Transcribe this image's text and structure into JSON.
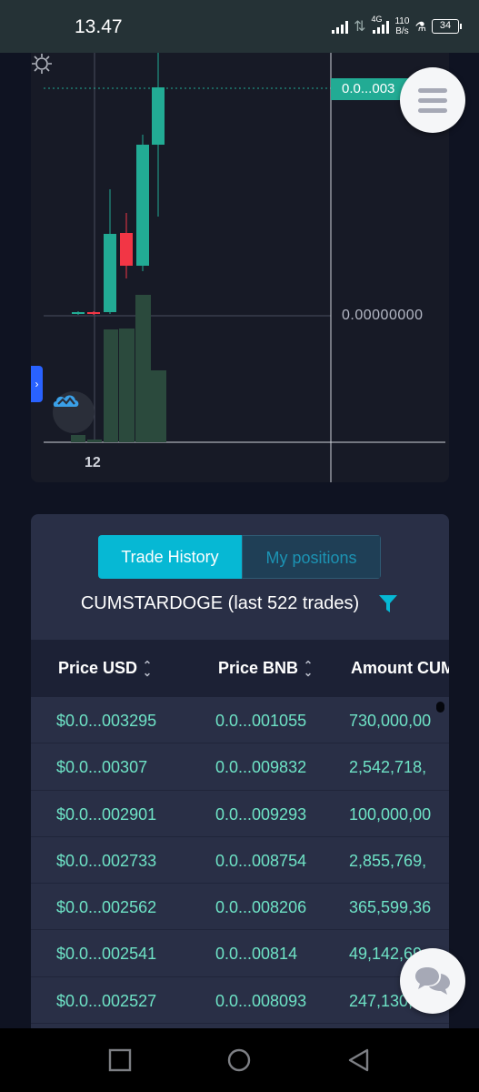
{
  "status_bar": {
    "time": "13.47",
    "network": "4G",
    "speed_value": "110",
    "speed_unit": "B/s",
    "battery": "34"
  },
  "chart": {
    "price_tag": "0.0...003",
    "zero_label": "0.00000000",
    "time_label": "12",
    "accent_up": "#22ab94",
    "accent_down": "#f23645"
  },
  "chart_data": {
    "type": "candlestick",
    "candles": [
      {
        "open": 0.0,
        "close": 0.0,
        "direction": "up"
      },
      {
        "open": 0.0,
        "close": 0.0,
        "direction": "down"
      },
      {
        "open": "low",
        "close": "high",
        "direction": "up"
      },
      {
        "open": "high",
        "close": "low",
        "direction": "down"
      },
      {
        "open": "low",
        "close": "high",
        "direction": "up"
      },
      {
        "open": "low",
        "close": "high",
        "direction": "up"
      }
    ],
    "volume_bars": 7,
    "price_labels": [
      "0.0...003",
      "0.00000000"
    ],
    "x_labels": [
      "12"
    ]
  },
  "trades": {
    "tabs": [
      {
        "label": "Trade History",
        "active": true
      },
      {
        "label": "My positions",
        "active": false
      }
    ],
    "title": "CUMSTARDOGE (last 522 trades)",
    "columns": [
      "Price USD",
      "Price BNB",
      "Amount CUM"
    ],
    "rows": [
      {
        "usd": "$0.0...003295",
        "bnb": "0.0...001055",
        "amount": "730,000,00"
      },
      {
        "usd": "$0.0...00307",
        "bnb": "0.0...009832",
        "amount": "2,542,718,"
      },
      {
        "usd": "$0.0...002901",
        "bnb": "0.0...009293",
        "amount": "100,000,00"
      },
      {
        "usd": "$0.0...002733",
        "bnb": "0.0...008754",
        "amount": "2,855,769,"
      },
      {
        "usd": "$0.0...002562",
        "bnb": "0.0...008206",
        "amount": "365,599,36"
      },
      {
        "usd": "$0.0...002541",
        "bnb": "0.0...00814",
        "amount": "49,142,69"
      },
      {
        "usd": "$0.0...002527",
        "bnb": "0.0...008093",
        "amount": "247,130,"
      }
    ]
  },
  "icons": {
    "menu": "hamburger-icon",
    "chat": "chat-bubbles-icon",
    "filter": "filter-icon",
    "settings": "gear-icon",
    "logo": "tradingview-cloud-icon"
  }
}
